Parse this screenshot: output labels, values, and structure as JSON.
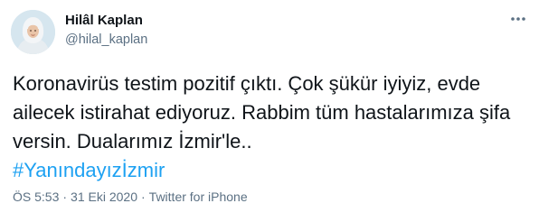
{
  "author": {
    "name": "Hilâl Kaplan",
    "handle": "@hilal_kaplan",
    "avatar_icon": "profile-photo-icon"
  },
  "more_icon": "more-dots-icon",
  "tweet": {
    "lines": [
      "Koronavirüs testim pozitif çıktı. Çok şükür iyiyiz, evde",
      "ailecek istirahat ediyoruz. Rabbim tüm hastalarımıza şifa",
      "versin. Dualarımız İzmir'le.."
    ],
    "hashtag": "#Yanındayızİzmir"
  },
  "meta": {
    "time": "ÖS 5:53",
    "separator": "·",
    "date": "31 Eki 2020",
    "source": "Twitter for iPhone"
  },
  "colors": {
    "link": "#1da1f2",
    "secondary_text": "#5b7083",
    "primary_text": "#0f1419"
  }
}
